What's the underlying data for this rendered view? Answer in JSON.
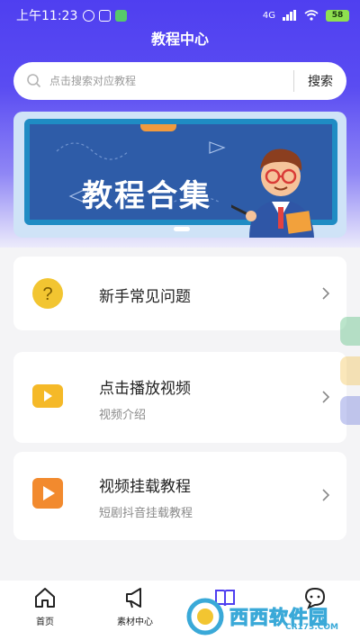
{
  "status_bar": {
    "time": "上午11:23",
    "network": "4G",
    "battery": "58"
  },
  "header": {
    "title": "教程中心"
  },
  "search": {
    "placeholder": "点击搜索对应教程",
    "button_label": "搜索"
  },
  "banner": {
    "title": "教程合集"
  },
  "tutorials": [
    {
      "title": "新手常见问题",
      "subtitle": "",
      "icon": "question-icon",
      "color": "#f2c531"
    },
    {
      "title": "点击播放视频",
      "subtitle": "视频介绍",
      "icon": "video-camera-icon",
      "color": "#f5b928"
    },
    {
      "title": "视频挂载教程",
      "subtitle": "短剧抖音挂载教程",
      "icon": "play-icon",
      "color": "#f28a2e"
    }
  ],
  "bottom_nav": [
    {
      "label": "首页",
      "icon": "home-icon"
    },
    {
      "label": "素材中心",
      "icon": "megaphone-icon"
    },
    {
      "label": "",
      "icon": "book-icon"
    },
    {
      "label": "",
      "icon": "chat-icon"
    }
  ],
  "watermark": {
    "text": "西西软件园",
    "url": "CR173.COM"
  },
  "colors": {
    "brand": "#4f3ff0",
    "board": "#2e5ca8"
  }
}
